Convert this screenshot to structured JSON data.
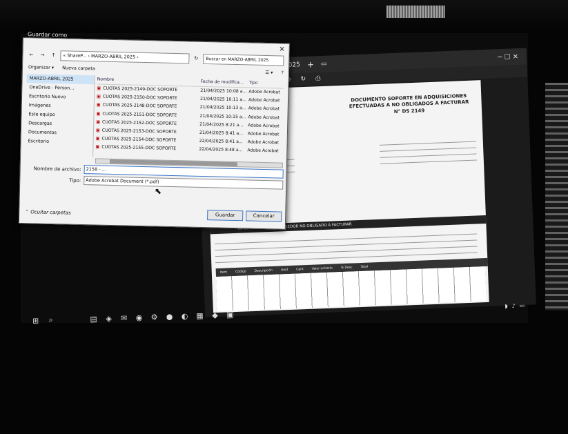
{
  "dialog": {
    "title": "Guardar como",
    "address": "« ShareP... › MARZO-ABRIL 2025 ›",
    "search_placeholder": "Buscar en MARZO-ABRIL 2025",
    "organize": "Organizar ▾",
    "new_folder": "Nueva carpeta",
    "nav_items": [
      "MARZO-ABRIL 2025",
      "OneDrive - Person...",
      "Escritorio Nuevo",
      "Imágenes",
      "Este equipo",
      "Descargas",
      "Documentos",
      "Escritorio"
    ],
    "columns": {
      "name": "Nombre",
      "date": "Fecha de modifica...",
      "type": "Tipo"
    },
    "files": [
      {
        "name": "CUOTAS 2025-2149-DOC SOPORTE",
        "date": "21/04/2025 10:08 a...",
        "type": "Adobe Acrobat"
      },
      {
        "name": "CUOTAS 2025-2150-DOC SOPORTE",
        "date": "21/04/2025 10:11 a...",
        "type": "Adobe Acrobat"
      },
      {
        "name": "CUOTAS 2025-2148-DOC SOPORTE",
        "date": "21/04/2025 10:13 a...",
        "type": "Adobe Acrobat"
      },
      {
        "name": "CUOTAS 2025-2151-DOC SOPORTE",
        "date": "21/04/2025 10:15 a...",
        "type": "Adobe Acrobat"
      },
      {
        "name": "CUOTAS 2025-2152-DOC SOPORTE",
        "date": "21/04/2025 8:21 a...",
        "type": "Adobe Acrobat"
      },
      {
        "name": "CUOTAS 2025-2153-DOC SOPORTE",
        "date": "21/04/2025 8:41 a...",
        "type": "Adobe Acrobat"
      },
      {
        "name": "CUOTAS 2025-2154-DOC SOPORTE",
        "date": "22/04/2025 8:41 a...",
        "type": "Adobe Acrobat"
      },
      {
        "name": "CUOTAS 2025-2155-DOC SOPORTE",
        "date": "22/04/2025 8:48 a...",
        "type": "Adobe Acrobat"
      }
    ],
    "filename_label": "Nombre de archivo:",
    "filename_value": "2158 - ...",
    "type_label": "Tipo:",
    "type_value": "Adobe Acrobat Document (*.pdf)",
    "hide_folders": "Ocultar carpetas",
    "save_label": "Guardar",
    "cancel_label": "Cancelar"
  },
  "viewer": {
    "tab_title": "...2025",
    "doc_title": "DOCUMENTO SOPORTE EN ADQUISICIONES EFECTUADAS A NO OBLIGADOS A FACTURAR",
    "doc_number": "N° DS 2149",
    "band_text": "INFORMACIÓN DEL PROVEEDOR NO OBLIGADO A FACTURAR",
    "table_headers": [
      "Item",
      "Código",
      "Descripción",
      "Unid",
      "Cant",
      "Valor unitario",
      "% Desc",
      "Total"
    ]
  }
}
